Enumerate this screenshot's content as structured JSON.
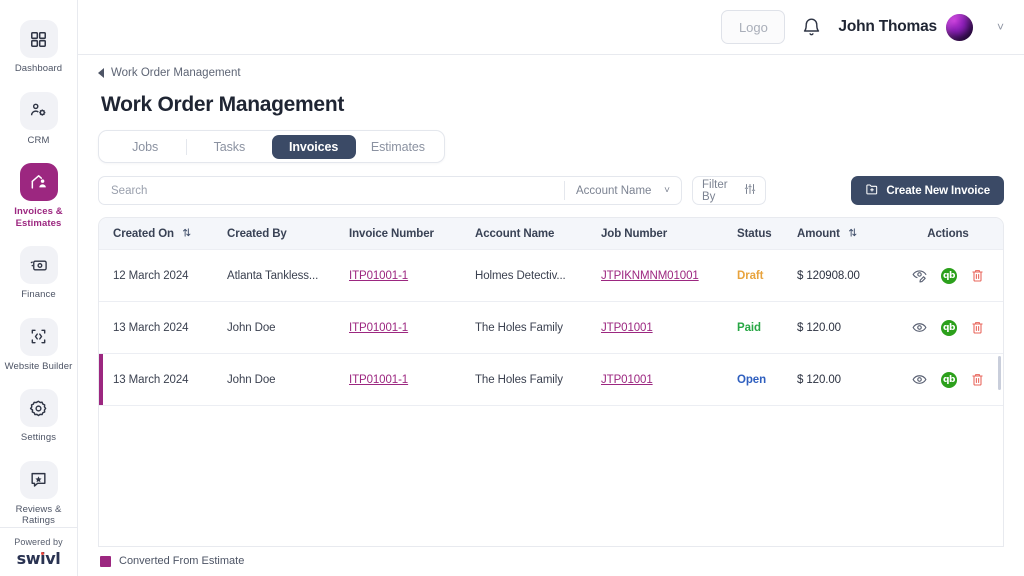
{
  "sidebar": {
    "items": [
      {
        "label": "Dashboard",
        "icon": "grid-icon",
        "active": false
      },
      {
        "label": "CRM",
        "icon": "user-gear-icon",
        "active": false
      },
      {
        "label": "Invoices & Estimates",
        "icon": "invoice-home-icon",
        "active": true
      },
      {
        "label": "Finance",
        "icon": "money-icon",
        "active": false
      },
      {
        "label": "Website Builder",
        "icon": "code-brackets-icon",
        "active": false
      },
      {
        "label": "Settings",
        "icon": "gear-icon",
        "active": false
      },
      {
        "label": "Reviews & Ratings",
        "icon": "star-chat-icon",
        "active": false
      }
    ],
    "footer": {
      "powered_by": "Powered by",
      "brand": "swivl"
    },
    "active_color": "#9c2780"
  },
  "topbar": {
    "logo_placeholder": "Logo",
    "bell_icon": "bell-icon",
    "user_name": "John Thomas",
    "avatar_icon": "avatar",
    "caret_icon": "chevron-down-icon"
  },
  "breadcrumb": {
    "items": [
      "Work Order Management"
    ]
  },
  "page": {
    "title": "Work Order Management"
  },
  "tabs": [
    {
      "label": "Jobs",
      "active": false
    },
    {
      "label": "Tasks",
      "active": false
    },
    {
      "label": "Invoices",
      "active": true
    },
    {
      "label": "Estimates",
      "active": false
    }
  ],
  "toolbar": {
    "search_placeholder": "Search",
    "search_value": "",
    "account_select_value": "Account Name",
    "filter_label": "Filter By",
    "filter_icon": "sliders-icon",
    "create_label": "Create New Invoice",
    "create_icon": "folder-plus-icon"
  },
  "table": {
    "columns": [
      {
        "label": "Created On",
        "sortable": true
      },
      {
        "label": "Created By",
        "sortable": false
      },
      {
        "label": "Invoice Number",
        "sortable": false
      },
      {
        "label": "Account Name",
        "sortable": false
      },
      {
        "label": "Job Number",
        "sortable": false
      },
      {
        "label": "Status",
        "sortable": false
      },
      {
        "label": "Amount",
        "sortable": true
      },
      {
        "label": "Actions",
        "sortable": false
      }
    ],
    "rows": [
      {
        "created_on": "12 March 2024",
        "created_by": "Atlanta Tankless...",
        "invoice_number": "ITP01001-1",
        "account_name": "Holmes Detectiv...",
        "job_number": "JTPIKNMNM01001",
        "status": "Draft",
        "status_kind": "draft",
        "amount": "$ 120908.00",
        "flagged": false,
        "actions": [
          "eye-edit-icon",
          "quickbooks-icon",
          "trash-icon"
        ]
      },
      {
        "created_on": "13 March 2024",
        "created_by": "John Doe",
        "invoice_number": "ITP01001-1",
        "account_name": "The Holes Family",
        "job_number": "JTP01001",
        "status": "Paid",
        "status_kind": "paid",
        "amount": "$ 120.00",
        "flagged": false,
        "actions": [
          "eye-icon",
          "quickbooks-icon",
          "trash-icon"
        ]
      },
      {
        "created_on": "13 March 2024",
        "created_by": "John Doe",
        "invoice_number": "ITP01001-1",
        "account_name": "The Holes Family",
        "job_number": "JTP01001",
        "status": "Open",
        "status_kind": "open",
        "amount": "$ 120.00",
        "flagged": true,
        "actions": [
          "eye-icon",
          "quickbooks-icon",
          "trash-icon"
        ]
      }
    ]
  },
  "legend": {
    "label": "Converted From Estimate",
    "color": "#9c2780"
  },
  "colors": {
    "accent": "#9c2780",
    "dark": "#3b4a66",
    "draft": "#e8a33d",
    "paid": "#28a745",
    "open": "#2f5fbf",
    "quickbooks": "#2ca01c",
    "danger": "#e8645a"
  }
}
